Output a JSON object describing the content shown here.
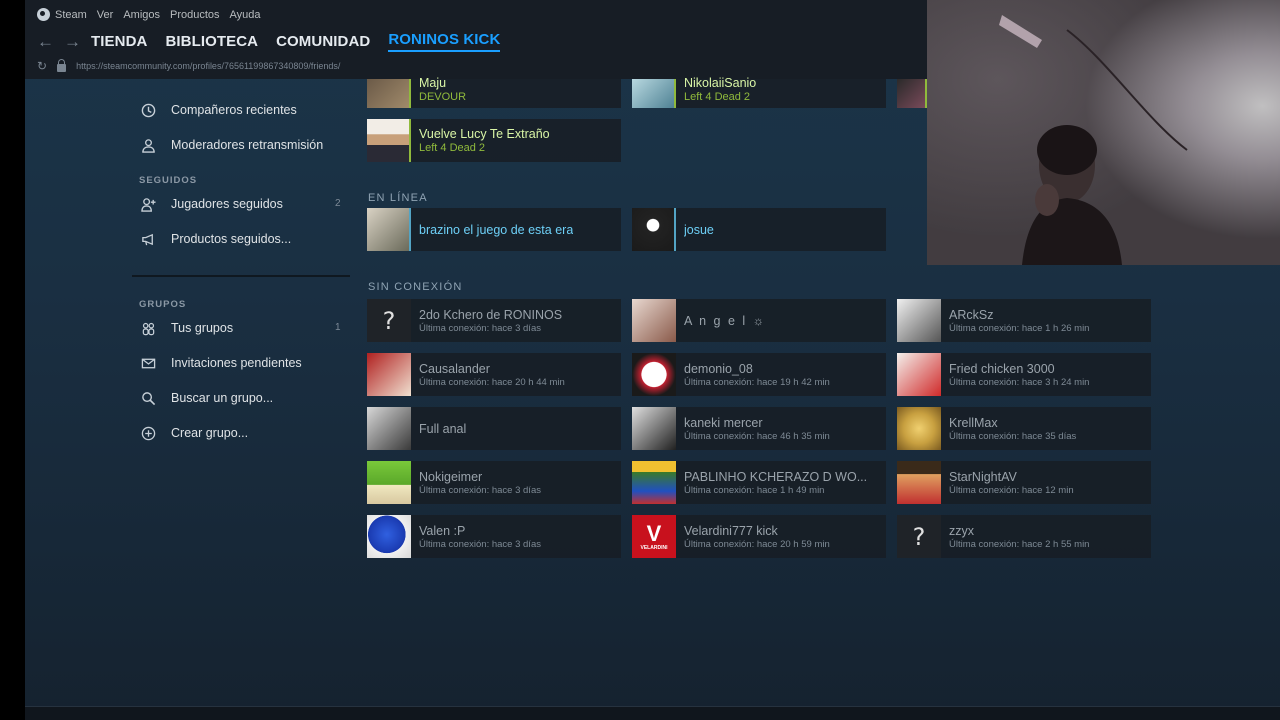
{
  "menu": {
    "steam": "Steam",
    "items": [
      "Ver",
      "Amigos",
      "Productos",
      "Ayuda"
    ]
  },
  "nav": {
    "tabs": [
      "TIENDA",
      "BIBLIOTECA",
      "COMUNIDAD",
      "RONINOS KICK"
    ],
    "active_index": 3
  },
  "address_bar": {
    "url": "https://steamcommunity.com/profiles/76561199867340809/friends/"
  },
  "sidebar": {
    "items_top": [
      {
        "label": "Compañeros recientes",
        "icon": "clock-icon"
      },
      {
        "label": "Moderadores retransmisión",
        "icon": "person-icon"
      }
    ],
    "following_heading": "SEGUIDOS",
    "following": [
      {
        "label": "Jugadores seguidos",
        "count": "2",
        "icon": "person-plus-icon"
      },
      {
        "label": "Productos seguidos...",
        "icon": "megaphone-icon"
      }
    ],
    "groups_heading": "GRUPOS",
    "groups": [
      {
        "label": "Tus grupos",
        "count": "1",
        "icon": "group-icon"
      },
      {
        "label": "Invitaciones pendientes",
        "icon": "envelope-icon"
      },
      {
        "label": "Buscar un grupo...",
        "icon": "search-icon"
      },
      {
        "label": "Crear grupo...",
        "icon": "plus-circle-icon"
      }
    ]
  },
  "in_game": [
    {
      "name": "Maju",
      "game": "DEVOUR"
    },
    {
      "name": "NikolaiiSanio",
      "game": "Left 4 Dead 2"
    },
    {
      "name": "Vuelve Lucy Te Extraño",
      "game": "Left 4 Dead 2"
    }
  ],
  "online_label": "EN LÍNEA",
  "online": [
    {
      "name": "brazino el juego de esta era"
    },
    {
      "name": "josue"
    }
  ],
  "offline_label": "SIN CONEXIÓN",
  "offline": [
    {
      "name": "2do Kchero de RONINOS",
      "status": "Última conexión: hace 3 días"
    },
    {
      "name": "A n g e l ☼",
      "status": ""
    },
    {
      "name": "ARckSz",
      "status": "Última conexión: hace 1 h 26 min"
    },
    {
      "name": "Causalander",
      "status": "Última conexión: hace 20 h 44 min"
    },
    {
      "name": "demonio_08",
      "status": "Última conexión: hace 19 h 42 min"
    },
    {
      "name": "Fried chicken 3000",
      "status": "Última conexión: hace 3 h 24 min"
    },
    {
      "name": "Full anal",
      "status": ""
    },
    {
      "name": "kaneki mercer",
      "status": "Última conexión: hace 46 h 35 min"
    },
    {
      "name": "KrellMax",
      "status": "Última conexión: hace 35 días"
    },
    {
      "name": "Nokigeimer",
      "status": "Última conexión: hace 3 días"
    },
    {
      "name": "PABLINHO KCHERAZO D WO...",
      "status": "Última conexión: hace 1 h 49 min"
    },
    {
      "name": "StarNightAV",
      "status": "Última conexión: hace 12 min"
    },
    {
      "name": "Valen :P",
      "status": "Última conexión: hace 3 días"
    },
    {
      "name": "Velardini777 kick",
      "status": "Última conexión: hace 20 h 59 min"
    },
    {
      "name": "zzyx",
      "status": "Última conexión: hace 2 h 55 min"
    }
  ],
  "avatar_text": {
    "unknown": "?",
    "velardini_letter": "V",
    "velardini_word": "VELARDINI"
  }
}
